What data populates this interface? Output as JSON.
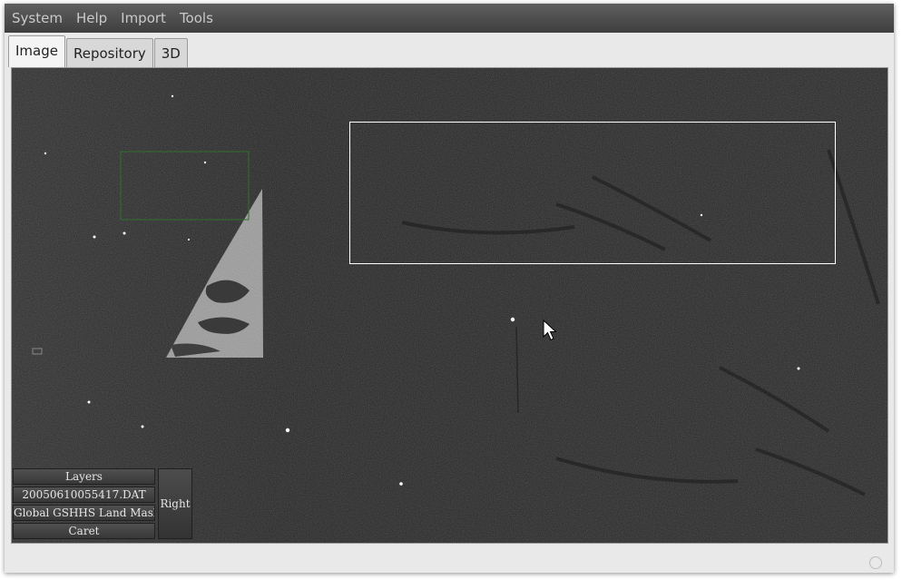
{
  "menu": [
    "System",
    "Help",
    "Import",
    "Tools"
  ],
  "tabs": [
    "Image",
    "Repository",
    "3D"
  ],
  "active_tab": "Image",
  "layers_panel": {
    "items": [
      "Layers",
      "20050610055417.DAT",
      "Global GSHHS Land Mask",
      "Caret"
    ],
    "side_button": "Right"
  },
  "colors": {
    "menubar": "#4a4a4a",
    "menu_text": "#c9c9c9",
    "image_background": "#333333",
    "green_selection": "#2f6f2f",
    "white_selection": "#ffffff",
    "land_mask": "#8c8c8c"
  },
  "icons": [
    "mouse-cursor-icon",
    "status-circle-icon",
    "thumbnail-icon"
  ]
}
